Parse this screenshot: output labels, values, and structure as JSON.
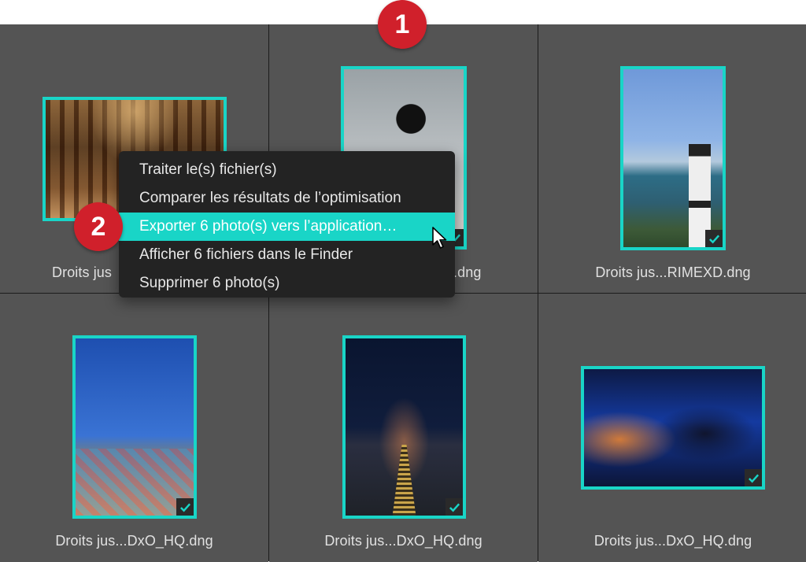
{
  "colors": {
    "accent": "#19d5c7",
    "cell_bg": "#545454",
    "menu_bg": "#232323",
    "badge": "#d0202b"
  },
  "badges": [
    "1",
    "2"
  ],
  "photos": [
    {
      "filename": "Droits jus...DxO_HQ.dng",
      "subject": "opera-interior",
      "checked": true
    },
    {
      "filename": "Droits jus...DxO_HQ.dng",
      "subject": "sky-figure",
      "checked": true
    },
    {
      "filename": "Droits jus...RIMEXD.dng",
      "subject": "lighthouse-coast",
      "checked": true
    },
    {
      "filename": "Droits jus...DxO_HQ.dng",
      "subject": "windy-hair",
      "checked": true
    },
    {
      "filename": "Droits jus...DxO_HQ.dng",
      "subject": "night-pier",
      "checked": true
    },
    {
      "filename": "Droits jus...DxO_HQ.dng",
      "subject": "love-sign",
      "checked": true
    }
  ],
  "partial_labels": {
    "photo1": "Droits jus",
    "photo2": ".dng"
  },
  "context_menu": {
    "items": [
      {
        "label": "Traiter le(s) fichier(s)",
        "active": false
      },
      {
        "label": "Comparer les résultats de l’optimisation",
        "active": false
      },
      {
        "label": "Exporter 6 photo(s) vers l’application…",
        "active": true
      },
      {
        "label": "Afficher 6 fichiers dans le Finder",
        "active": false
      },
      {
        "label": "Supprimer 6 photo(s)",
        "active": false
      }
    ]
  },
  "icons": {
    "check": "checkmark-icon",
    "cursor": "mouse-pointer-icon"
  }
}
